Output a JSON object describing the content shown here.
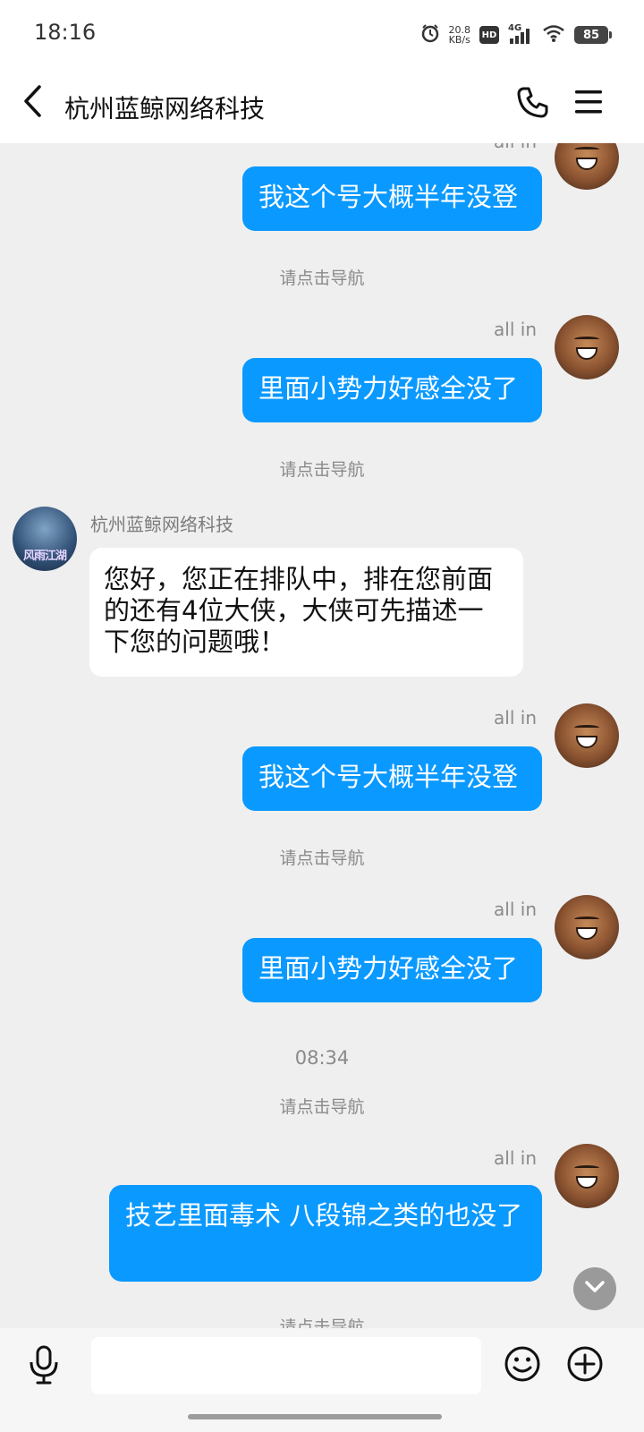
{
  "status_bar": {
    "time": "18:16",
    "net_speed_value": "20.8",
    "net_speed_unit": "KB/s",
    "hd_label": "HD",
    "network_label": "4G",
    "battery_level": "85",
    "icons": [
      "alarm-icon",
      "signal-icon",
      "wifi-icon",
      "battery-icon"
    ]
  },
  "header": {
    "title": "杭州蓝鲸网络科技",
    "icons": [
      "back-icon",
      "phone-icon",
      "menu-icon"
    ]
  },
  "chat": {
    "me_name": "all  in",
    "bot_name": "杭州蓝鲸网络科技",
    "bot_avatar_text": "风雨江湖",
    "messages": [
      {
        "type": "out",
        "text": "我这个号大概半年没登"
      },
      {
        "type": "system",
        "text": "请点击导航"
      },
      {
        "type": "out",
        "sender": "all  in",
        "text": "里面小势力好感全没了"
      },
      {
        "type": "system",
        "text": "请点击导航"
      },
      {
        "type": "in",
        "sender": "杭州蓝鲸网络科技",
        "text": "您好，您正在排队中，排在您前面的还有4位大侠，大侠可先描述一下您的问题哦！"
      },
      {
        "type": "out",
        "sender": "all  in",
        "text": "我这个号大概半年没登"
      },
      {
        "type": "system",
        "text": "请点击导航"
      },
      {
        "type": "out",
        "sender": "all  in",
        "text": "里面小势力好感全没了"
      },
      {
        "type": "time",
        "text": "08:34"
      },
      {
        "type": "system",
        "text": "请点击导航"
      },
      {
        "type": "out",
        "sender": "all  in",
        "text": "技艺里面毒术  八段锦之类的也没了"
      },
      {
        "type": "system",
        "text": "请点击导航"
      }
    ]
  },
  "input_bar": {
    "placeholder": "",
    "icons": [
      "microphone-icon",
      "emoji-icon",
      "plus-icon"
    ]
  },
  "colors": {
    "accent": "#0a99ff",
    "background": "#efefef"
  }
}
